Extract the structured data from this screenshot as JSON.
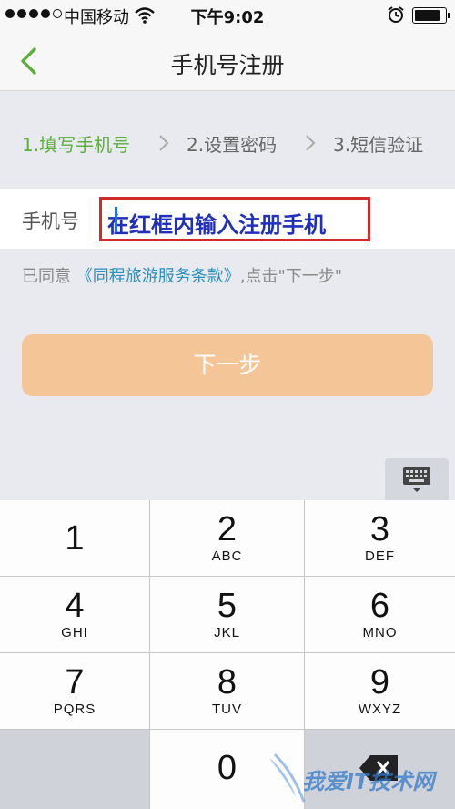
{
  "status_bar": {
    "carrier": "中国移动",
    "time": "下午9:02",
    "battery_level": 0.85
  },
  "nav": {
    "title": "手机号注册"
  },
  "steps": [
    {
      "label": "1.填写手机号",
      "active": true
    },
    {
      "label": "2.设置密码",
      "active": false
    },
    {
      "label": "3.短信验证",
      "active": false
    }
  ],
  "form": {
    "phone_label": "手机号",
    "phone_value": "在红框内输入注册手机",
    "agreement_prefix": "已同意",
    "agreement_link": "《同程旅游服务条款》",
    "agreement_suffix": ",点击\"下一步\"",
    "next_label": "下一步"
  },
  "keypad": {
    "keys": [
      {
        "num": "1",
        "letters": ""
      },
      {
        "num": "2",
        "letters": "ABC"
      },
      {
        "num": "3",
        "letters": "DEF"
      },
      {
        "num": "4",
        "letters": "GHI"
      },
      {
        "num": "5",
        "letters": "JKL"
      },
      {
        "num": "6",
        "letters": "MNO"
      },
      {
        "num": "7",
        "letters": "PQRS"
      },
      {
        "num": "8",
        "letters": "TUV"
      },
      {
        "num": "9",
        "letters": "WXYZ"
      },
      {
        "num": "",
        "letters": ""
      },
      {
        "num": "0",
        "letters": ""
      },
      {
        "num": "",
        "letters": ""
      }
    ]
  },
  "watermark": {
    "text": "我爱IT技术网"
  },
  "colors": {
    "accent_green": "#5dae3b",
    "link_blue": "#2b8fbd",
    "button_orange": "#f4c596",
    "highlight_red": "#d02a2a"
  },
  "icons": [
    "signal-dots-icon",
    "wifi-icon",
    "alarm-icon",
    "battery-icon",
    "back-chevron-icon",
    "step-chevron-icon",
    "keyboard-icon",
    "delete-icon"
  ]
}
